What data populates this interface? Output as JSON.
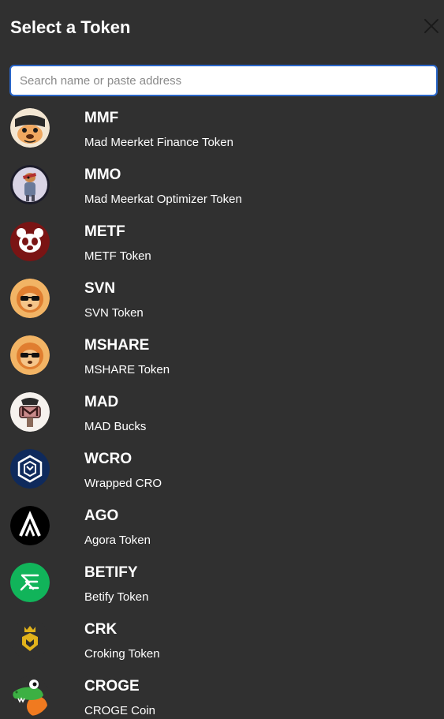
{
  "modal": {
    "title": "Select a Token",
    "close_icon": "close-icon"
  },
  "search": {
    "placeholder": "Search name or paste address",
    "value": ""
  },
  "tokens": [
    {
      "symbol": "MMF",
      "name": "Mad Meerket Finance Token",
      "icon": "mmf-logo-icon"
    },
    {
      "symbol": "MMO",
      "name": "Mad Meerkat Optimizer Token",
      "icon": "mmo-logo-icon"
    },
    {
      "symbol": "METF",
      "name": "METF Token",
      "icon": "metf-logo-icon"
    },
    {
      "symbol": "SVN",
      "name": "SVN Token",
      "icon": "svn-logo-icon"
    },
    {
      "symbol": "MSHARE",
      "name": "MSHARE Token",
      "icon": "mshare-logo-icon"
    },
    {
      "symbol": "MAD",
      "name": "MAD Bucks",
      "icon": "mad-logo-icon"
    },
    {
      "symbol": "WCRO",
      "name": "Wrapped CRO",
      "icon": "wcro-logo-icon"
    },
    {
      "symbol": "AGO",
      "name": "Agora Token",
      "icon": "ago-logo-icon"
    },
    {
      "symbol": "BETIFY",
      "name": "Betify Token",
      "icon": "betify-logo-icon"
    },
    {
      "symbol": "CRK",
      "name": "Croking Token",
      "icon": "crk-logo-icon"
    },
    {
      "symbol": "CROGE",
      "name": "CROGE Coin",
      "icon": "croge-logo-icon"
    }
  ]
}
